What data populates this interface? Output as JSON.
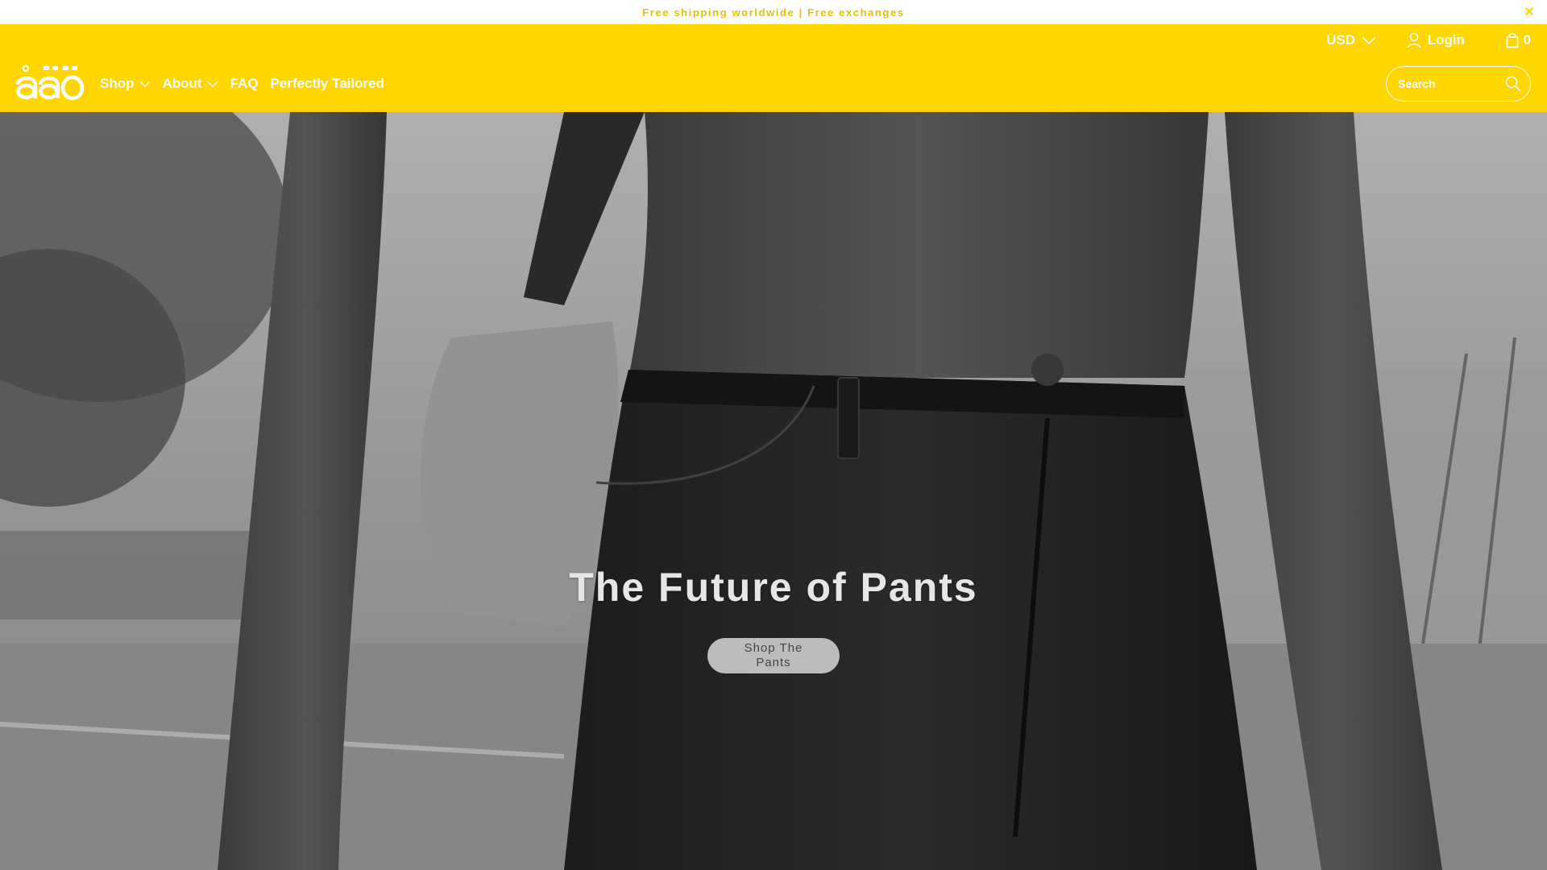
{
  "announcement": {
    "text": "Free shipping worldwide | Free exchanges",
    "close_label": "×"
  },
  "header": {
    "background": "#ffd600",
    "currency": "USD",
    "login_label": "Login",
    "cart_count": "0",
    "logo_alt": "äāö",
    "nav": [
      {
        "label": "Shop",
        "has_dropdown": true
      },
      {
        "label": "About",
        "has_dropdown": true
      },
      {
        "label": "FAQ",
        "has_dropdown": false
      },
      {
        "label": "Perfectly Tailored",
        "has_dropdown": false
      }
    ],
    "search_placeholder": "Search"
  },
  "hero": {
    "title": "The Future of Pants",
    "cta_label": "Shop The Pants"
  },
  "colors": {
    "accent_yellow": "#ffd600",
    "announce_text": "#e6c200"
  }
}
